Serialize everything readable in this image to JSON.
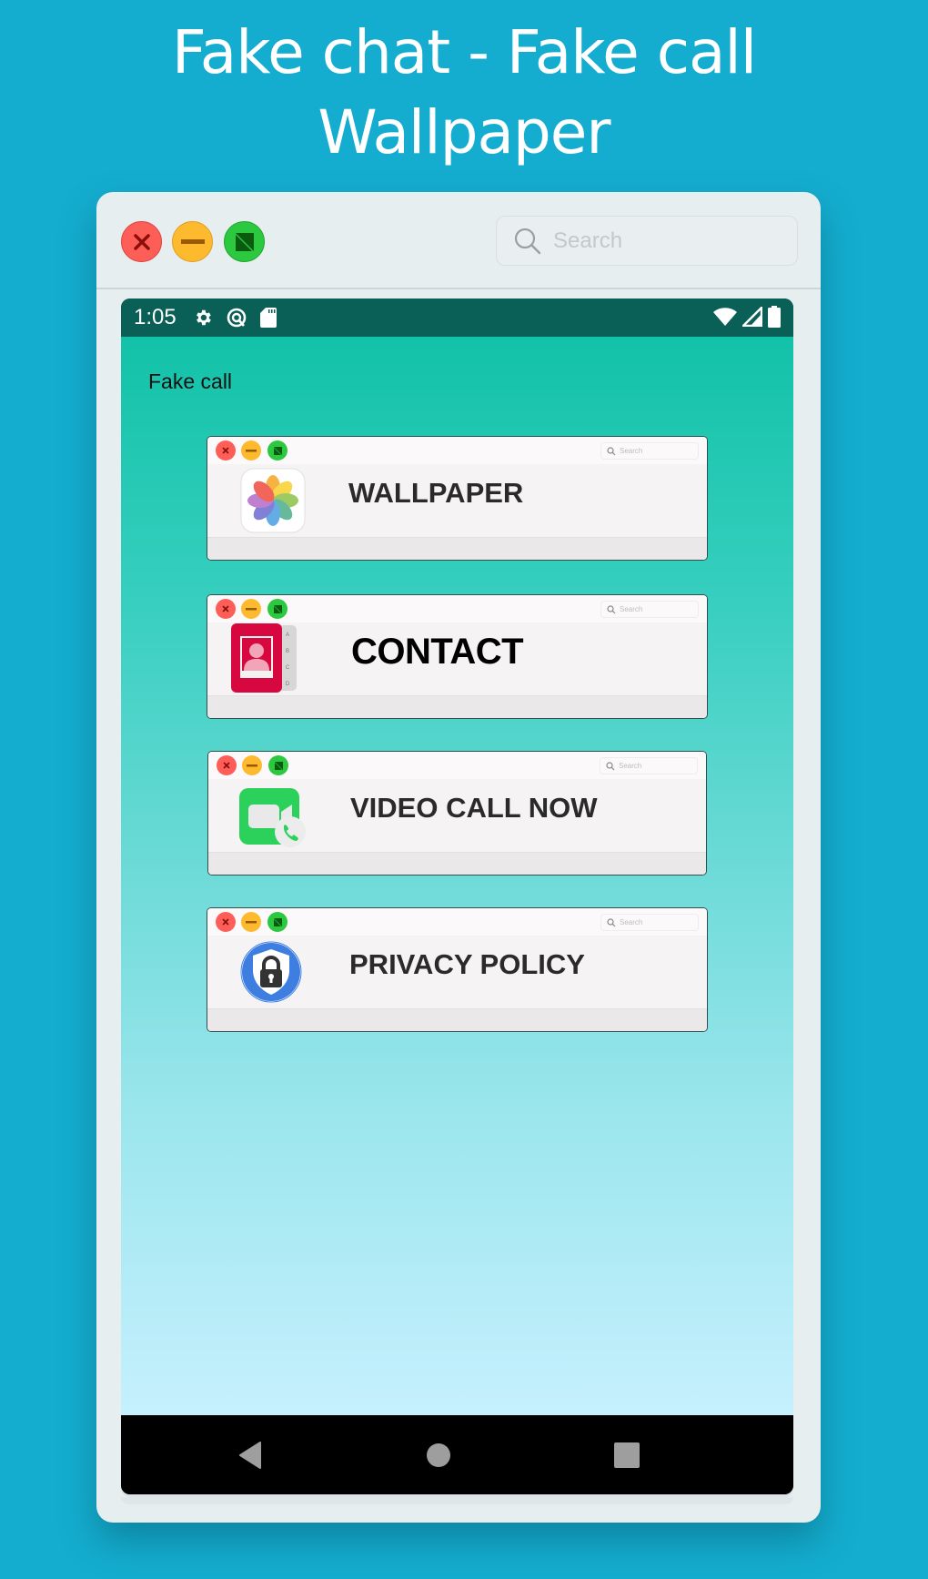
{
  "headline": {
    "line1": "Fake chat - Fake call",
    "line2": "Wallpaper"
  },
  "window": {
    "controls": {
      "close": "close",
      "minimize": "minimize",
      "maximize": "maximize"
    },
    "search": {
      "placeholder": "Search",
      "icon": "search-icon"
    }
  },
  "statusbar": {
    "time": "1:05",
    "left_icons": [
      "gear-icon",
      "data-saver-icon",
      "sd-card-icon"
    ],
    "right_icons": [
      "wifi-icon",
      "signal-icon",
      "battery-icon"
    ]
  },
  "screen": {
    "title": "Fake call",
    "gradient": [
      "#12c2a8",
      "#6edbd8",
      "#c6f0fe"
    ]
  },
  "menu": [
    {
      "label": "WALLPAPER",
      "icon": "photos-icon",
      "search_placeholder": "Search"
    },
    {
      "label": "CONTACT",
      "icon": "contacts-icon",
      "search_placeholder": "Search"
    },
    {
      "label": "VIDEO CALL NOW",
      "icon": "facetime-icon",
      "search_placeholder": "Search"
    },
    {
      "label": "PRIVACY POLICY",
      "icon": "shield-lock-icon",
      "search_placeholder": "Search"
    }
  ],
  "navbar": {
    "back": "back",
    "home": "home",
    "recents": "recents"
  },
  "colors": {
    "background": "#14adcf",
    "statusbar": "#0a5f56",
    "close": "#fd5f58",
    "minimize": "#feba2f",
    "maximize": "#2bc840"
  }
}
